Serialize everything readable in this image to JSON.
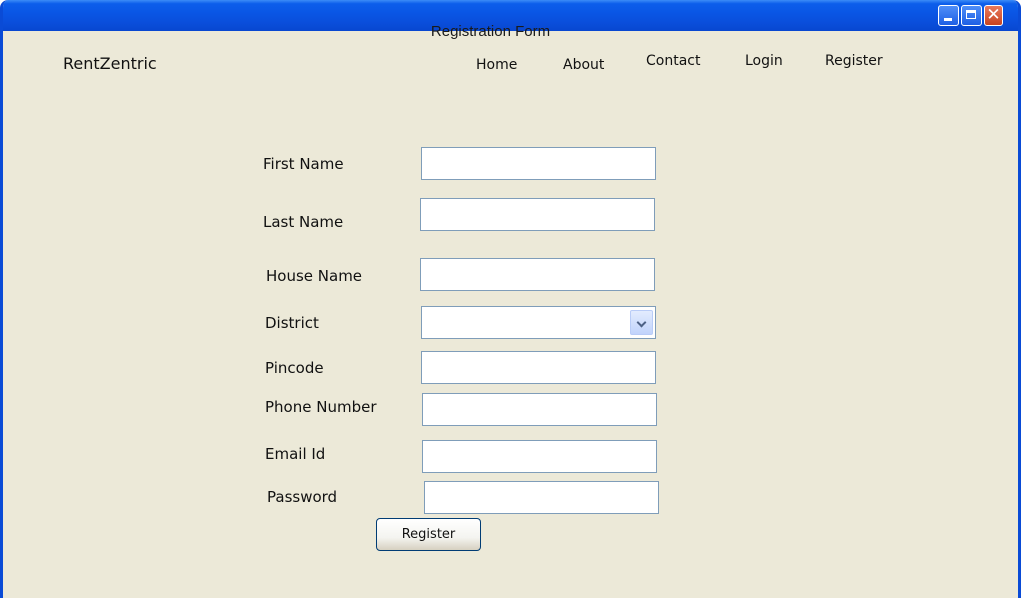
{
  "window": {
    "title": "Registration Form",
    "close_glyph": "✕"
  },
  "header": {
    "brand": "RentZentric",
    "nav": {
      "home": "Home",
      "about": "About",
      "contact": "Contact",
      "login": "Login",
      "register": "Register"
    }
  },
  "form": {
    "first_name_label": "First Name",
    "last_name_label": "Last Name",
    "house_name_label": "House Name",
    "district_label": "District",
    "pincode_label": "Pincode",
    "phone_label": "Phone Number",
    "email_label": "Email Id",
    "password_label": "Password",
    "first_name_value": "",
    "last_name_value": "",
    "house_name_value": "",
    "district_value": "",
    "pincode_value": "",
    "phone_value": "",
    "email_value": "",
    "password_value": "",
    "submit_label": "Register"
  },
  "icons": {
    "minimize": "minimize-icon",
    "maximize": "maximize-icon",
    "close": "close-icon",
    "dropdown": "chevron-down-icon"
  },
  "colors": {
    "titlebar": "#0A55E4",
    "window_bg": "#ECE9D8",
    "field_border": "#7F9DB9"
  }
}
